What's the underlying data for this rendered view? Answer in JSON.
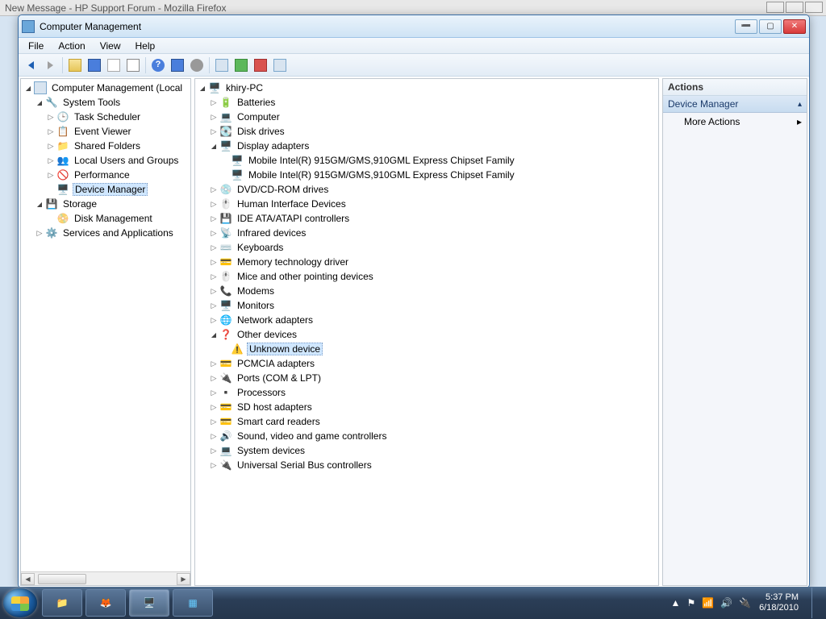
{
  "background_browser_title": "New Message - HP Support Forum - Mozilla Firefox",
  "window": {
    "title": "Computer Management"
  },
  "menu": {
    "file": "File",
    "action": "Action",
    "view": "View",
    "help": "Help"
  },
  "left_tree": {
    "root": "Computer Management (Local",
    "system_tools": "System Tools",
    "task_scheduler": "Task Scheduler",
    "event_viewer": "Event Viewer",
    "shared_folders": "Shared Folders",
    "local_users": "Local Users and Groups",
    "performance": "Performance",
    "device_manager": "Device Manager",
    "storage": "Storage",
    "disk_mgmt": "Disk Management",
    "services_apps": "Services and Applications"
  },
  "center_tree": {
    "root": "khiry-PC",
    "batteries": "Batteries",
    "computer": "Computer",
    "disk_drives": "Disk drives",
    "display_adapters": "Display adapters",
    "display_child1": "Mobile Intel(R) 915GM/GMS,910GML Express Chipset Family",
    "display_child2": "Mobile Intel(R) 915GM/GMS,910GML Express Chipset Family",
    "dvd": "DVD/CD-ROM drives",
    "hid": "Human Interface Devices",
    "ide": "IDE ATA/ATAPI controllers",
    "infrared": "Infrared devices",
    "keyboards": "Keyboards",
    "memtech": "Memory technology driver",
    "mice": "Mice and other pointing devices",
    "modems": "Modems",
    "monitors": "Monitors",
    "network": "Network adapters",
    "other": "Other devices",
    "unknown": "Unknown device",
    "pcmcia": "PCMCIA adapters",
    "ports": "Ports (COM & LPT)",
    "processors": "Processors",
    "sdhost": "SD host adapters",
    "smartcard": "Smart card readers",
    "sound": "Sound, video and game controllers",
    "system_devices": "System devices",
    "usb": "Universal Serial Bus controllers"
  },
  "actions": {
    "header": "Actions",
    "sub": "Device Manager",
    "more": "More Actions"
  },
  "taskbar": {
    "time": "5:37 PM",
    "date": "6/18/2010"
  }
}
